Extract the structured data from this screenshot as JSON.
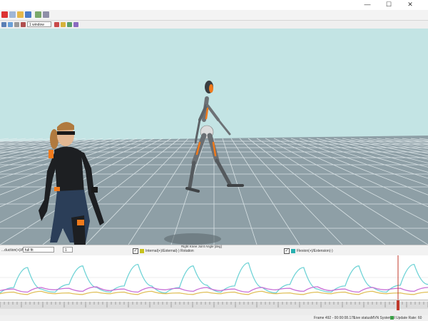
{
  "window": {
    "minimize": "—",
    "maximize": "☐",
    "close": "✕"
  },
  "toolbar2": {
    "mode_select": "1 window"
  },
  "graph_header": {
    "zoom_value": "full fit",
    "step_value": "1",
    "left_label": "...duction(+)/Adduction(-)",
    "title": "Right Knee Joint Angle [deg]",
    "series": [
      {
        "label": "Internal(+)/External(-) Rotation",
        "color": "#c8c21e"
      },
      {
        "label": "Flexion(+)/Extension(-)",
        "color": "#2ab0b0"
      }
    ]
  },
  "chart_data": {
    "type": "line",
    "title": "Right Knee Joint Angle [deg]",
    "series": [
      {
        "name": "Flexion(+)/Extension(-)",
        "color": "#6fd3d6",
        "values": [
          5,
          12,
          38,
          10,
          6,
          16,
          40,
          12,
          6,
          14,
          42,
          14,
          5,
          12,
          40,
          15,
          6,
          14,
          44,
          12,
          5,
          16,
          38,
          10,
          6,
          14,
          40,
          12,
          6,
          15,
          42,
          16
        ]
      },
      {
        "name": "Internal(+)/External(-) Rotation",
        "color": "#c96fd6",
        "values": [
          8,
          10,
          6,
          12,
          9,
          11,
          7,
          13,
          8,
          10,
          6,
          12,
          9,
          11,
          7,
          12,
          8,
          10,
          6,
          12,
          9,
          11,
          7,
          13,
          8,
          10,
          6,
          12,
          9,
          11,
          7,
          12
        ]
      },
      {
        "name": "Abduction(+)/Adduction(-)",
        "color": "#e0c05a",
        "values": [
          4,
          6,
          3,
          7,
          4,
          5,
          3,
          6,
          4,
          6,
          3,
          7,
          4,
          5,
          3,
          6,
          4,
          6,
          3,
          7,
          4,
          5,
          3,
          6,
          4,
          6,
          3,
          7,
          4,
          5,
          3,
          6
        ]
      }
    ],
    "cursor_position": 0.93
  },
  "status": {
    "frame": "Frame 492 - 00:00:08.170",
    "live_status": "Live status:",
    "system": "MVN System R",
    "update_rate": "Update Rate: 60"
  },
  "colors": {
    "sky": "#c3e4e4",
    "floor": "#8e9fa6",
    "grid": "#e8eef0",
    "suit": "#1d1f22",
    "accent": "#f07a1c"
  }
}
